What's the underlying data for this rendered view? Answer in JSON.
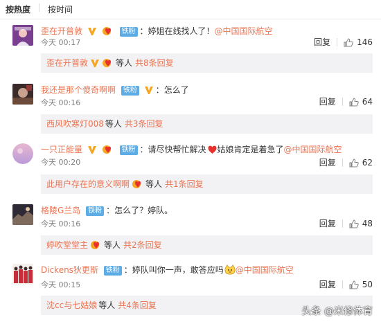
{
  "sort": {
    "hot": "按热度",
    "time": "按时间"
  },
  "comments": [
    {
      "name": "歪在开普敦",
      "fan": "铁粉",
      "text": "婷姐在线找人了！",
      "mention": "@中国国际航空",
      "time": "今天 00:17",
      "reply": "回复",
      "likes": "146",
      "sub_name": "歪在开普敦",
      "sub_wait": "等人",
      "sub_more": "共8条回复"
    },
    {
      "name": "我还是那个傻奇啊啊",
      "fan": "铁粉",
      "text": "怎么了",
      "mention": "",
      "time": "今天 00:16",
      "reply": "回复",
      "likes": "64",
      "sub_name": "西风吹寒灯008",
      "sub_wait": "等人",
      "sub_more": "共3条回复"
    },
    {
      "name": "一只正能量",
      "fan": "铁粉",
      "text": "请尽快帮忙解决",
      "text2": "姑娘肯定是着急了",
      "mention": "@中国国际航空",
      "time": "今天 00:20",
      "reply": "回复",
      "likes": "62",
      "sub_name": "此用户存在的意义啊啊",
      "sub_wait": "等人",
      "sub_more": "共1条回复"
    },
    {
      "name": "格陵G兰岛",
      "fan": "铁粉",
      "text": "怎么了？婷队。",
      "mention": "",
      "time": "今天 00:16",
      "reply": "回复",
      "likes": "48",
      "sub_name": "婷吹堂堂主",
      "sub_wait": "等人",
      "sub_more": "共2条回复"
    },
    {
      "name": "Dickens狄更斯",
      "fan": "铁粉",
      "text": "婷队叫你一声，敢答应吗",
      "mention": "@中国国际航空",
      "time": "今天 00:15",
      "reply": "回复",
      "likes": "50",
      "sub_name": "沈cc与七姑娘",
      "sub_wait": "等人",
      "sub_more": "共4条回复"
    }
  ],
  "watermark": "头条 @米修体育",
  "colors": {
    "link": "#eb7350",
    "fan_badge": "#5dace6",
    "vip": "#f5a623",
    "heart": "#e8302c"
  }
}
